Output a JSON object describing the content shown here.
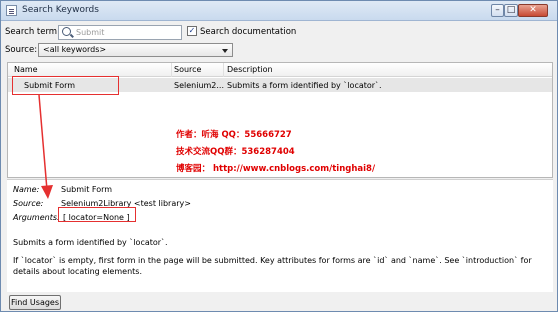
{
  "window": {
    "title": "Search Keywords",
    "minimize": "–",
    "maximize": "□",
    "close": "✕"
  },
  "search": {
    "label": "Search term:",
    "placeholder": "Submit",
    "checkbox_label": "Search documentation",
    "checked": true
  },
  "source_filter": {
    "label": "Source:",
    "selected": "<all keywords>"
  },
  "table": {
    "columns": [
      "Name",
      "Source",
      "Description"
    ],
    "rows": [
      {
        "name": "Submit Form",
        "source": "Selenium2...",
        "description": "Submits a form identified by `locator`."
      }
    ]
  },
  "annotation": {
    "author": "作者：听海  QQ：55666727",
    "group": "技术交流QQ群：536287404",
    "blog": "博客园：  http://www.cnblogs.com/tinghai8/",
    "color": "#e00000"
  },
  "details": {
    "name_label": "Name:",
    "name_value": "Submit Form",
    "source_label": "Source:",
    "source_value": "Selenium2Library <test library>",
    "args_label": "Arguments:",
    "args_value": "[ locator=None ]",
    "doc_line1": "Submits a form identified by `locator`.",
    "doc_line2": "If `locator` is empty, first form in the page will be submitted. Key attributes for forms are `id` and `name`. See `introduction` for details about locating elements."
  },
  "buttons": {
    "find_usages": "Find Usages"
  }
}
